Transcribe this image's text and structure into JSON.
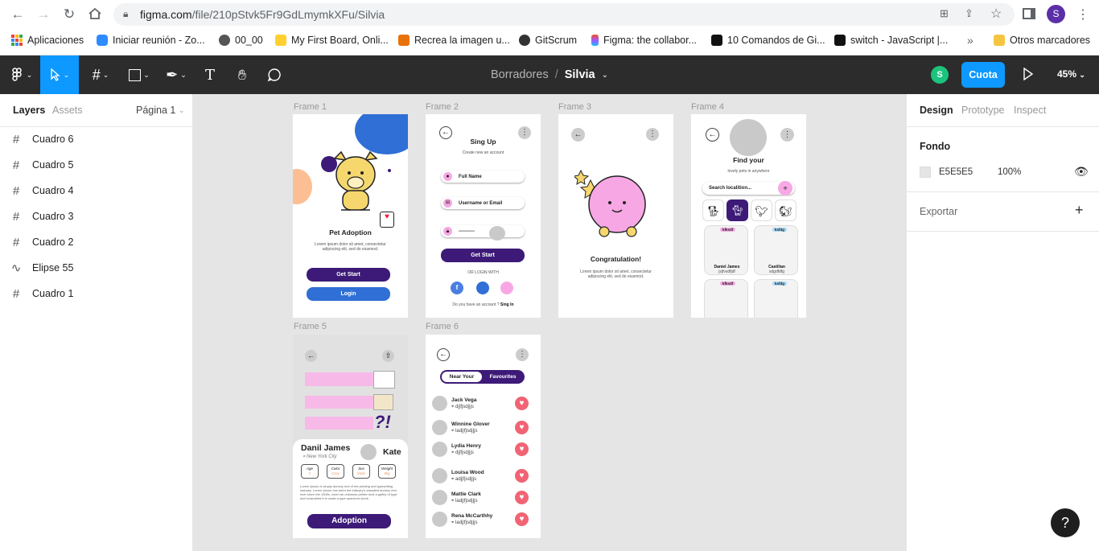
{
  "browser": {
    "url_host": "figma.com",
    "url_path": "/file/210pStvk5Fr9GdLmymkXFu/Silvia",
    "profile_initial": "S",
    "bookmarks": [
      {
        "label": "Aplicaciones",
        "color": "#4285f4"
      },
      {
        "label": "Iniciar reunión - Zo...",
        "color": "#2d8cff"
      },
      {
        "label": "00_00",
        "color": "#555555"
      },
      {
        "label": "My First Board, Onli...",
        "color": "#ffd02f"
      },
      {
        "label": "Recrea la imagen u...",
        "color": "#e8710a"
      },
      {
        "label": "GitScrum",
        "color": "#333333"
      },
      {
        "label": "Figma: the collabor...",
        "color": "#f24e1e"
      },
      {
        "label": "10 Comandos de Gi...",
        "color": "#111111"
      },
      {
        "label": "switch - JavaScript |...",
        "color": "#111111"
      }
    ],
    "more_label": "»",
    "other_bookmarks": "Otros marcadores"
  },
  "toolbar": {
    "breadcrumb_parent": "Borradores",
    "separator": "/",
    "file_name": "Silvia",
    "user_initial": "S",
    "share_label": "Cuota",
    "zoom": "45%"
  },
  "left_panel": {
    "tab_layers": "Layers",
    "tab_assets": "Assets",
    "page": "Página 1",
    "layers": [
      {
        "name": "Cuadro 6",
        "icon": "#"
      },
      {
        "name": "Cuadro 5",
        "icon": "#"
      },
      {
        "name": "Cuadro 4",
        "icon": "#"
      },
      {
        "name": "Cuadro 3",
        "icon": "#"
      },
      {
        "name": "Cuadro 2",
        "icon": "#"
      },
      {
        "name": "Elipse 55",
        "icon": "∿"
      },
      {
        "name": "Cuadro 1",
        "icon": "#"
      }
    ]
  },
  "right_panel": {
    "tab_design": "Design",
    "tab_prototype": "Prototype",
    "tab_inspect": "Inspect",
    "fondo_label": "Fondo",
    "fondo_hex": "E5E5E5",
    "fondo_opacity": "100%",
    "export_label": "Exportar"
  },
  "frames": {
    "f1": {
      "label": "Frame 1",
      "title": "Pet Adoption",
      "lorem": "Lorem ipsum dolor sit amet, consectetur adipiscing elit, sed do eiusmod.",
      "btn1": "Get Start",
      "btn2": "Login"
    },
    "f2": {
      "label": "Frame 2",
      "title": "Sing Up",
      "subtitle": "Create new an account",
      "field1": "Full Name",
      "field2": "Username or Email",
      "field3": "----------",
      "btn": "Get Start",
      "or": "OR LOGIN WITH",
      "have": "Do you have an account ?",
      "signin": "Sing In"
    },
    "f3": {
      "label": "Frame 3",
      "title": "Congratulation!",
      "lorem": "Lorem ipsum dolor sit amet, consectetur adipiscing elit, sed do eiusmod."
    },
    "f4": {
      "label": "Frame 4",
      "title": "Find your",
      "subtitle": "lovely pets in anywhere",
      "search": "Search localition...",
      "card1_tag": "kfksdf",
      "card2_tag": "ksfdg",
      "card1_name": "Daniel James",
      "card1_sub": "jsjfvsdfjdf",
      "card2_name": "Castilian",
      "card2_sub": "sdgdfdfg",
      "card3_tag": "kfksdf",
      "card4_tag": "ksfdg"
    },
    "f5": {
      "label": "Frame 5",
      "name1": "Danil James",
      "city": "New York City",
      "name2": "Kate",
      "stats": [
        {
          "k": "Age",
          "v": "2"
        },
        {
          "k": "Color",
          "v": "Grey"
        },
        {
          "k": "Sex",
          "v": "Male"
        },
        {
          "k": "Weight",
          "v": "8kg"
        }
      ],
      "lorem": "Lorem Ipsum is simply dummy text of the printing and typesetting industry. Lorem Ipsum has been the industry's standard dummy text ever since the 1500s, when an unknown printer took a galley of type and scrambled it to make a type specimen book.",
      "btn": "Adoption"
    },
    "f6": {
      "label": "Frame 6",
      "tab1": "Near Your",
      "tab2": "Favourites",
      "people": [
        {
          "name": "Jack Vega",
          "loc": "dj|fjsdj|js"
        },
        {
          "name": "Winnine Glover",
          "loc": "ladj|fjsdj|js"
        },
        {
          "name": "Lydia Henry",
          "loc": "dj|fjsdj|js"
        },
        {
          "name": "Louisa Wood",
          "loc": "adj|fjsdj|js"
        },
        {
          "name": "Mattie Clark",
          "loc": "ladj|fjsdj|js"
        },
        {
          "name": "Rena McCarthhy",
          "loc": "ladj|fjsdj|js"
        }
      ]
    }
  },
  "help_label": "?",
  "colors": {
    "accent": "#0d99ff",
    "purple": "#3d1a78",
    "blue": "#2f6fd6",
    "pink": "#f7a8e4"
  }
}
